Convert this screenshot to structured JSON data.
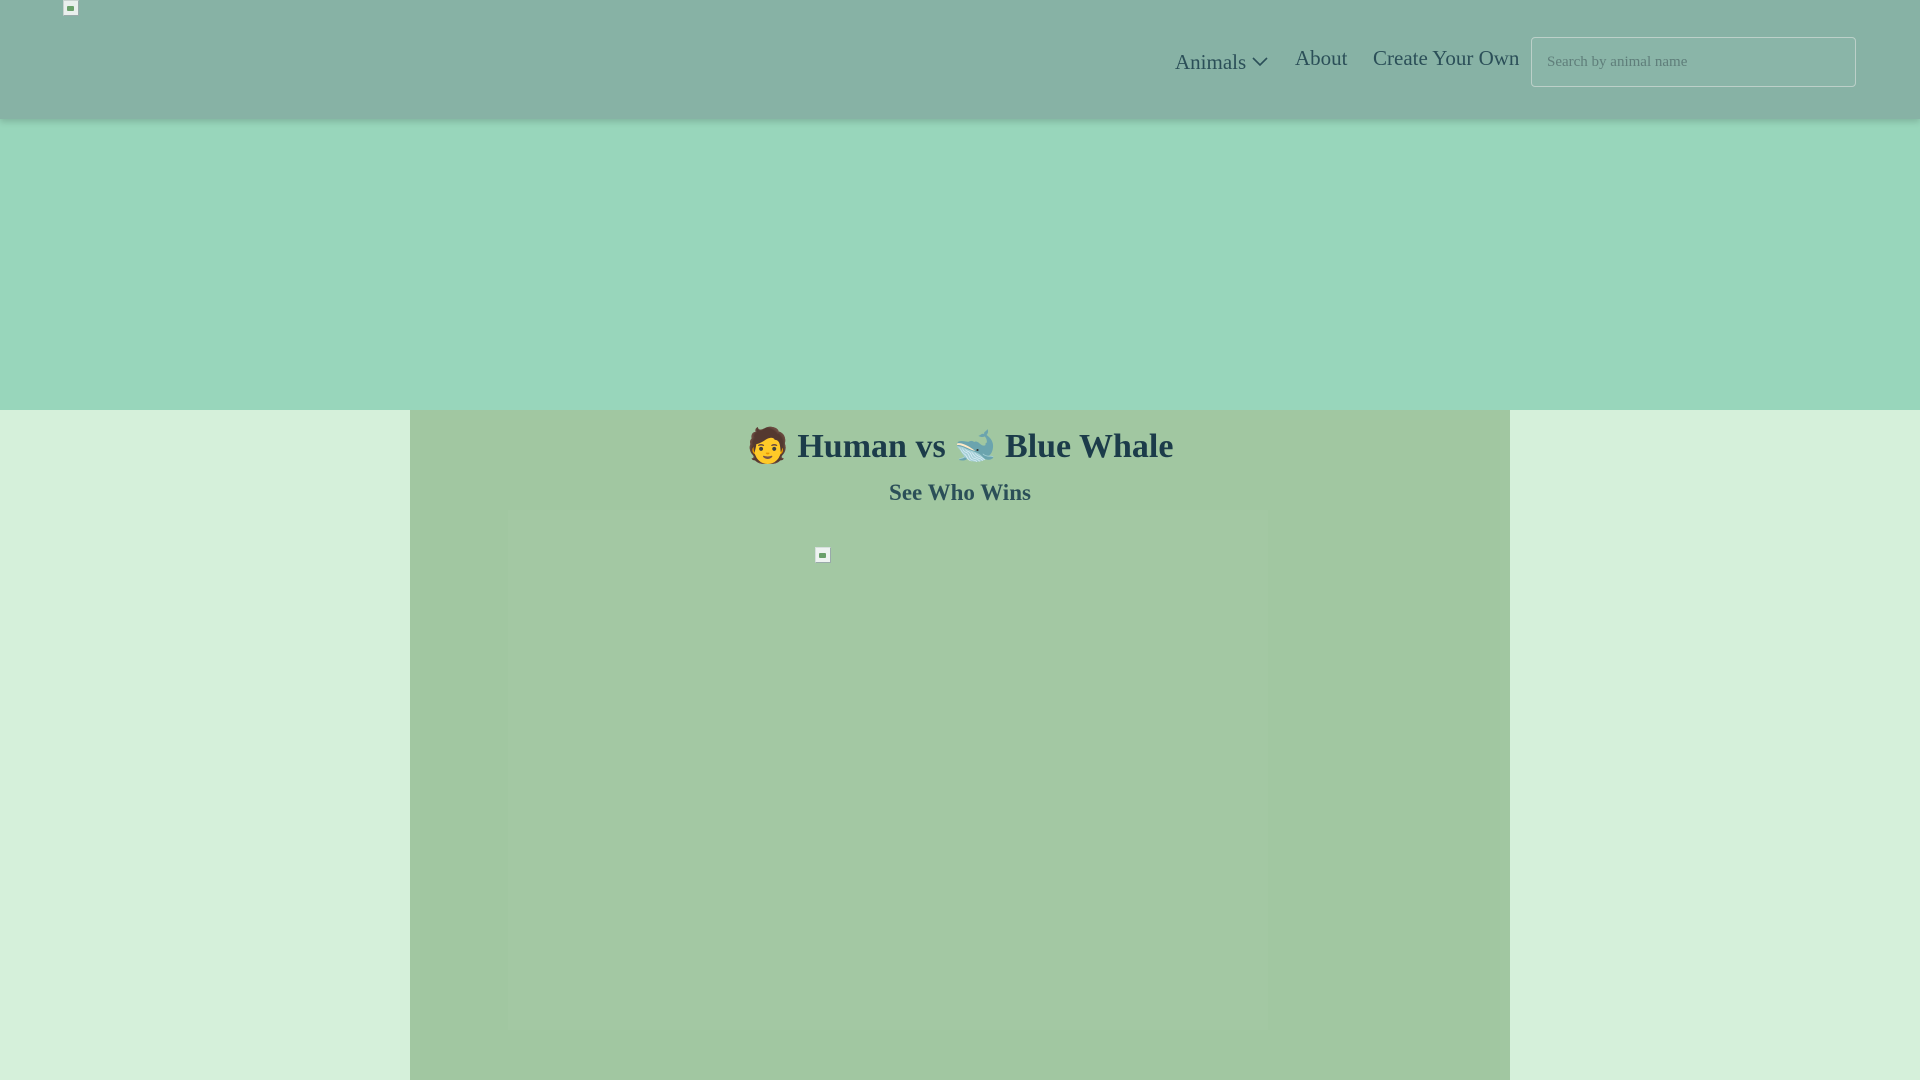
{
  "nav": {
    "links": [
      {
        "label": "Animals",
        "has_dropdown": true
      },
      {
        "label": "About"
      },
      {
        "label": "Create Your Own"
      }
    ],
    "search_placeholder": "Search by animal name"
  },
  "matchup": {
    "left_emoji": "🧑",
    "left_name": "Human",
    "vs": "vs",
    "right_emoji": "🐋",
    "right_name": "Blue Whale",
    "subtitle": "See Who Wins"
  },
  "colors": {
    "navbar": "#87b2a5",
    "banner": "#98d6bb",
    "page_background": "#d5f0da",
    "main_panel": "#a1c7a1",
    "text_dark": "#1c3c4a"
  }
}
